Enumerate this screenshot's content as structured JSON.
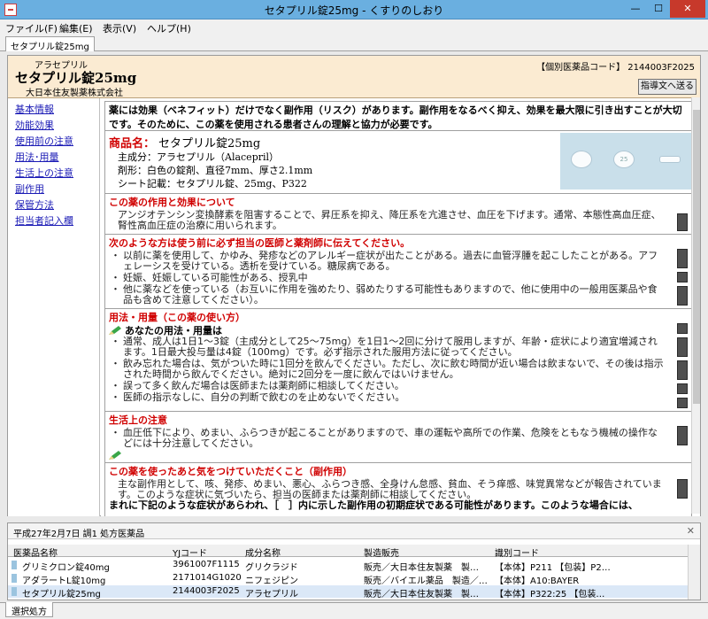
{
  "window": {
    "title": "セタプリル錠25mg - くすりのしおり"
  },
  "menu": [
    "ファイル(F)",
    "編集(E)",
    "表示(V)",
    "ヘルプ(H)"
  ],
  "doc_tab": "セタプリル錠25mg",
  "header": {
    "generic_name": "アラセプリル",
    "product_name": "セタプリル錠25mg",
    "maker": "大日本住友製薬株式会社",
    "code_label": "【個別医薬品コード】 2144003F2025",
    "guide_button": "指導文へ送る"
  },
  "nav": [
    "基本情報",
    "効能効果",
    "使用前の注意",
    "用法･用量",
    "生活上の注意",
    "副作用",
    "保管方法",
    "担当者記入欄"
  ],
  "intro": "薬には効果（ベネフィット）だけでなく副作用（リスク）があります。副作用をなるべく抑え、効果を最大限に引き出すことが大切です。そのために、この薬を使用される患者さんの理解と協力が必要です。",
  "product": {
    "label": "商品名：",
    "name": "セタプリル錠25mg",
    "ingredient": "主成分：アラセプリル（Alacepril）",
    "form": "剤形：白色の錠剤、直径7mm、厚さ2.1mm",
    "sheet": "シート記載：セタプリル錠、25mg、P322",
    "pill_mark": "25"
  },
  "sections": {
    "effect": {
      "heading": "この薬の作用と効果について",
      "body": "アンジオテンシン変換酵素を阻害することで、昇圧系を抑え、降圧系を亢進させ、血圧を下げます。通常、本態性高血圧症、腎性高血圧症の治療に用いられます。"
    },
    "before": {
      "heading": "次のような方は使う前に必ず担当の医師と薬剤師に伝えてください。",
      "items": [
        "以前に薬を使用して、かゆみ、発疹などのアレルギー症状が出たことがある。過去に血管浮腫を起こしたことがある。アフェレーシスを受けている。透析を受けている。糖尿病である。",
        "妊娠、妊娠している可能性がある、授乳中",
        "他に薬などを使っている（お互いに作用を強めたり、弱めたりする可能性もありますので、他に使用中の一般用医薬品や食品も含めて注意してください）。"
      ]
    },
    "dosage": {
      "heading": "用法・用量（この薬の使い方）",
      "sub": "あなたの用法・用量は",
      "items": [
        "通常、成人は1日1～3錠（主成分として25～75mg）を1日1～2回に分けて服用しますが、年齢・症状により適宜増減されます。1日最大投与量は4錠（100mg）です。必ず指示された服用方法に従ってください。",
        "飲み忘れた場合は、気がついた時に1回分を飲んでください。ただし、次に飲む時間が近い場合は飲まないで、その後は指示された時間から飲んでください。絶対に2回分を一度に飲んではいけません。",
        "誤って多く飲んだ場合は医師または薬剤師に相談してください。",
        "医師の指示なしに、自分の判断で飲むのを止めないでください。"
      ]
    },
    "life": {
      "heading": "生活上の注意",
      "items": [
        "血圧低下により、めまい、ふらつきが起こることがありますので、車の運転や高所での作業、危険をともなう機械の操作などには十分注意してください。"
      ]
    },
    "side": {
      "heading": "この薬を使ったあと気をつけていただくこと（副作用）",
      "body": "主な副作用として、咳、発疹、めまい、悪心、ふらつき感、全身けん怠感、貧血、そう痒感、味覚異常などが報告されています。このような症状に気づいたら、担当の医師または薬剤師に相談してください。",
      "more": "まれに下記のような症状があらわれ、［　］内に示した副作用の初期症状である可能性があります。このような場合には、"
    }
  },
  "prescription": {
    "title": "平成27年2月7日 調1 処方医薬品",
    "columns": [
      "医薬品名称",
      "YJコード",
      "成分名称",
      "製造販売",
      "識別コード"
    ],
    "rows": [
      [
        "グリミクロン錠40mg",
        "3961007F1115",
        "グリクラジド",
        "販売／大日本住友製薬　製…",
        "【本体】P211 【包装】P2…"
      ],
      [
        "アダラートL錠10mg",
        "2171014G1020",
        "ニフェジピン",
        "販売／バイエル薬品　製造／…",
        "【本体】A10:BAYER"
      ],
      [
        "セタプリル錠25mg",
        "2144003F2025",
        "アラセプリル",
        "販売／大日本住友製薬　製…",
        "【本体】P322:25 【包装…"
      ]
    ]
  },
  "bottom_tab": "選択処方"
}
